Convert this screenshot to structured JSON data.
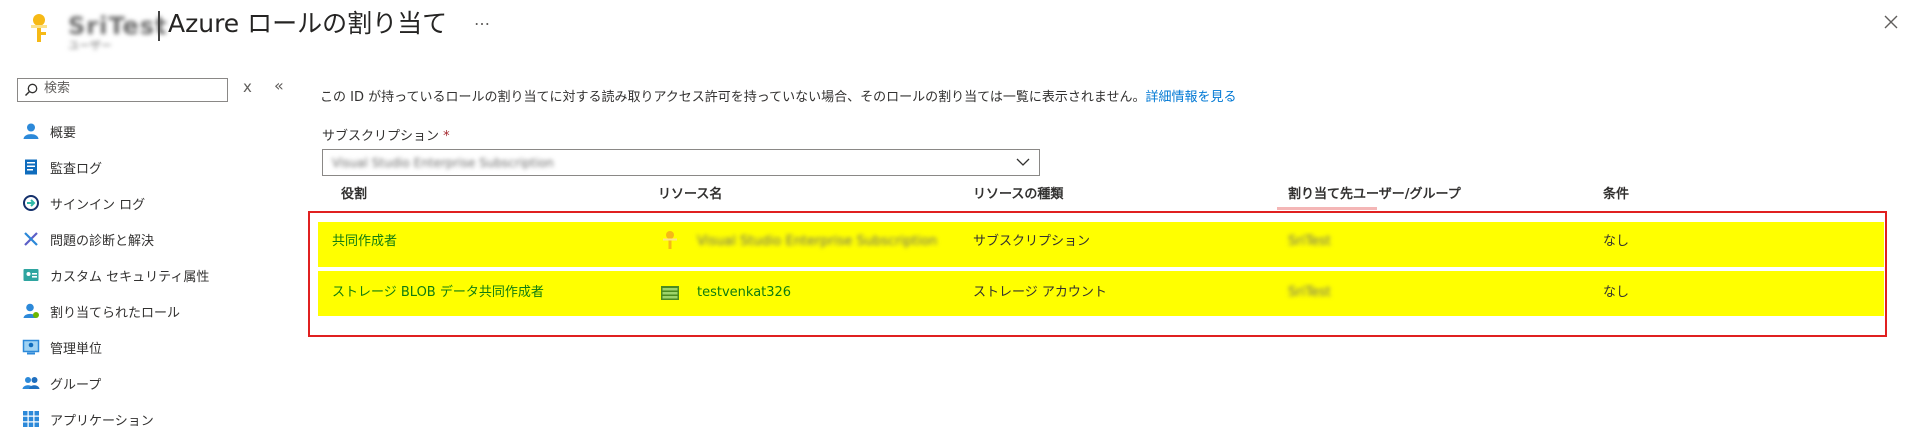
{
  "header": {
    "resource_name_blurred": "SriTest",
    "separator": "|",
    "title": "Azure ロールの割り当て",
    "more": "…",
    "subtitle_blurred": "ユーザー"
  },
  "sidebar": {
    "search_placeholder": "検索",
    "clear": "x",
    "collapse": "«",
    "items": [
      {
        "label": "概要",
        "icon": "user-icon"
      },
      {
        "label": "監査ログ",
        "icon": "audit-log-icon"
      },
      {
        "label": "サインイン ログ",
        "icon": "sign-in-log-icon"
      },
      {
        "label": "問題の診断と解決",
        "icon": "wrench-icon"
      },
      {
        "label": "カスタム セキュリティ属性",
        "icon": "custom-attribute-icon"
      },
      {
        "label": "割り当てられたロール",
        "icon": "assigned-roles-icon"
      },
      {
        "label": "管理単位",
        "icon": "admin-unit-icon"
      },
      {
        "label": "グループ",
        "icon": "groups-icon"
      },
      {
        "label": "アプリケーション",
        "icon": "applications-icon"
      }
    ]
  },
  "main": {
    "info_text": "この ID が持っているロールの割り当てに対する読み取りアクセス許可を持っていない場合、そのロールの割り当ては一覧に表示されません。",
    "info_link": "詳細情報を見る",
    "subscription_label": "サブスクリプション",
    "required_mark": "*",
    "subscription_value_blurred": "Visual Studio Enterprise Subscription",
    "table": {
      "columns": [
        "役割",
        "リソース名",
        "リソースの種類",
        "割り当て先ユーザー/グループ",
        "条件"
      ],
      "rows": [
        {
          "role": "共同作成者",
          "resource_name": "Visual Studio Enterprise Subscription",
          "resource_name_blurred": true,
          "resource_type": "サブスクリプション",
          "assigned_to": "SriTest",
          "condition": "なし"
        },
        {
          "role": "ストレージ BLOB データ共同作成者",
          "resource_name": "testvenkat326",
          "resource_name_blurred": false,
          "resource_type": "ストレージ アカウント",
          "assigned_to": "SriTest",
          "condition": "なし"
        }
      ]
    }
  },
  "colors": {
    "link_blue": "#0078d4",
    "role_green": "#107c10",
    "highlight_yellow": "#ffff00",
    "frame_red": "#e02020"
  }
}
